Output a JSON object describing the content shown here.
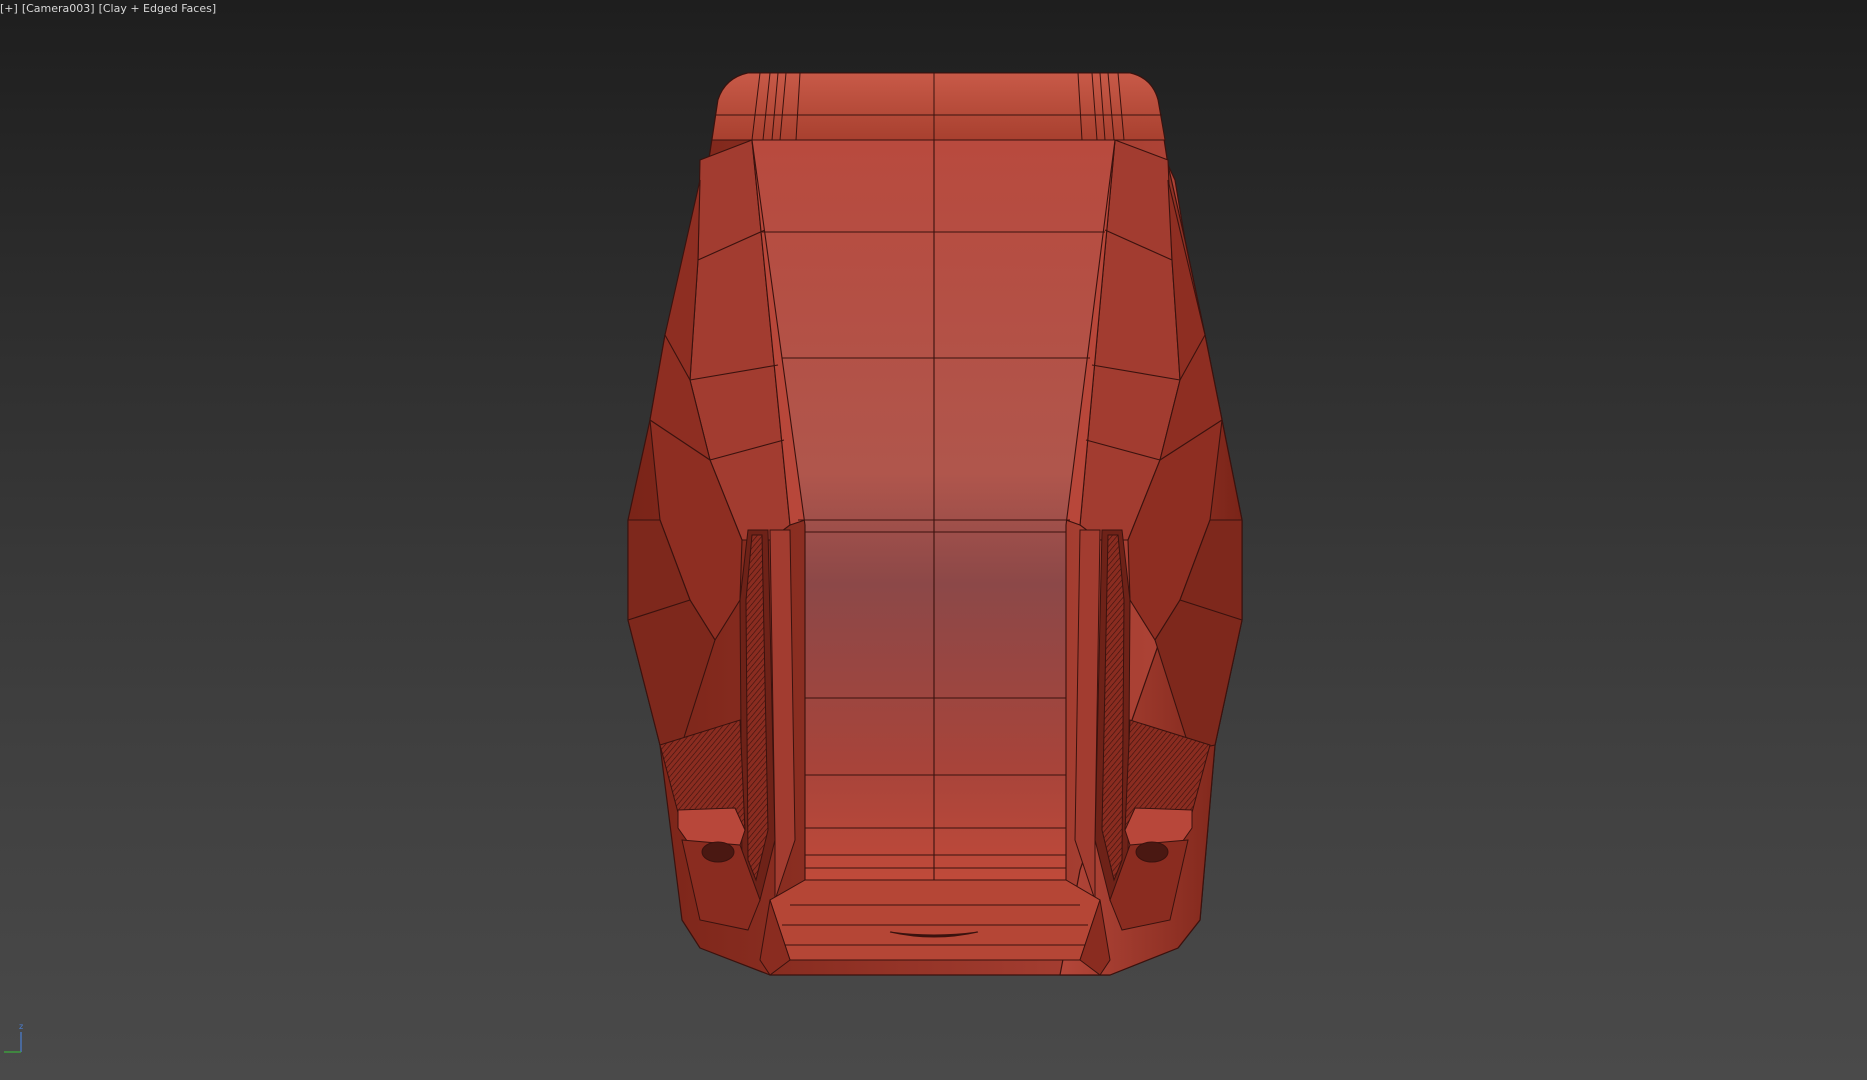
{
  "viewport": {
    "menu_label": "[+]",
    "camera_label": "[Camera003]",
    "shading_label": "[Clay + Edged Faces]",
    "background_top": "#1e1e1e",
    "background_bottom": "#4a4a4a"
  },
  "model": {
    "material_color": "#b0463a",
    "edge_color": "#3a120e",
    "shadow_color": "#6e221a"
  },
  "axis_gizmo": {
    "axis_label": "z"
  }
}
